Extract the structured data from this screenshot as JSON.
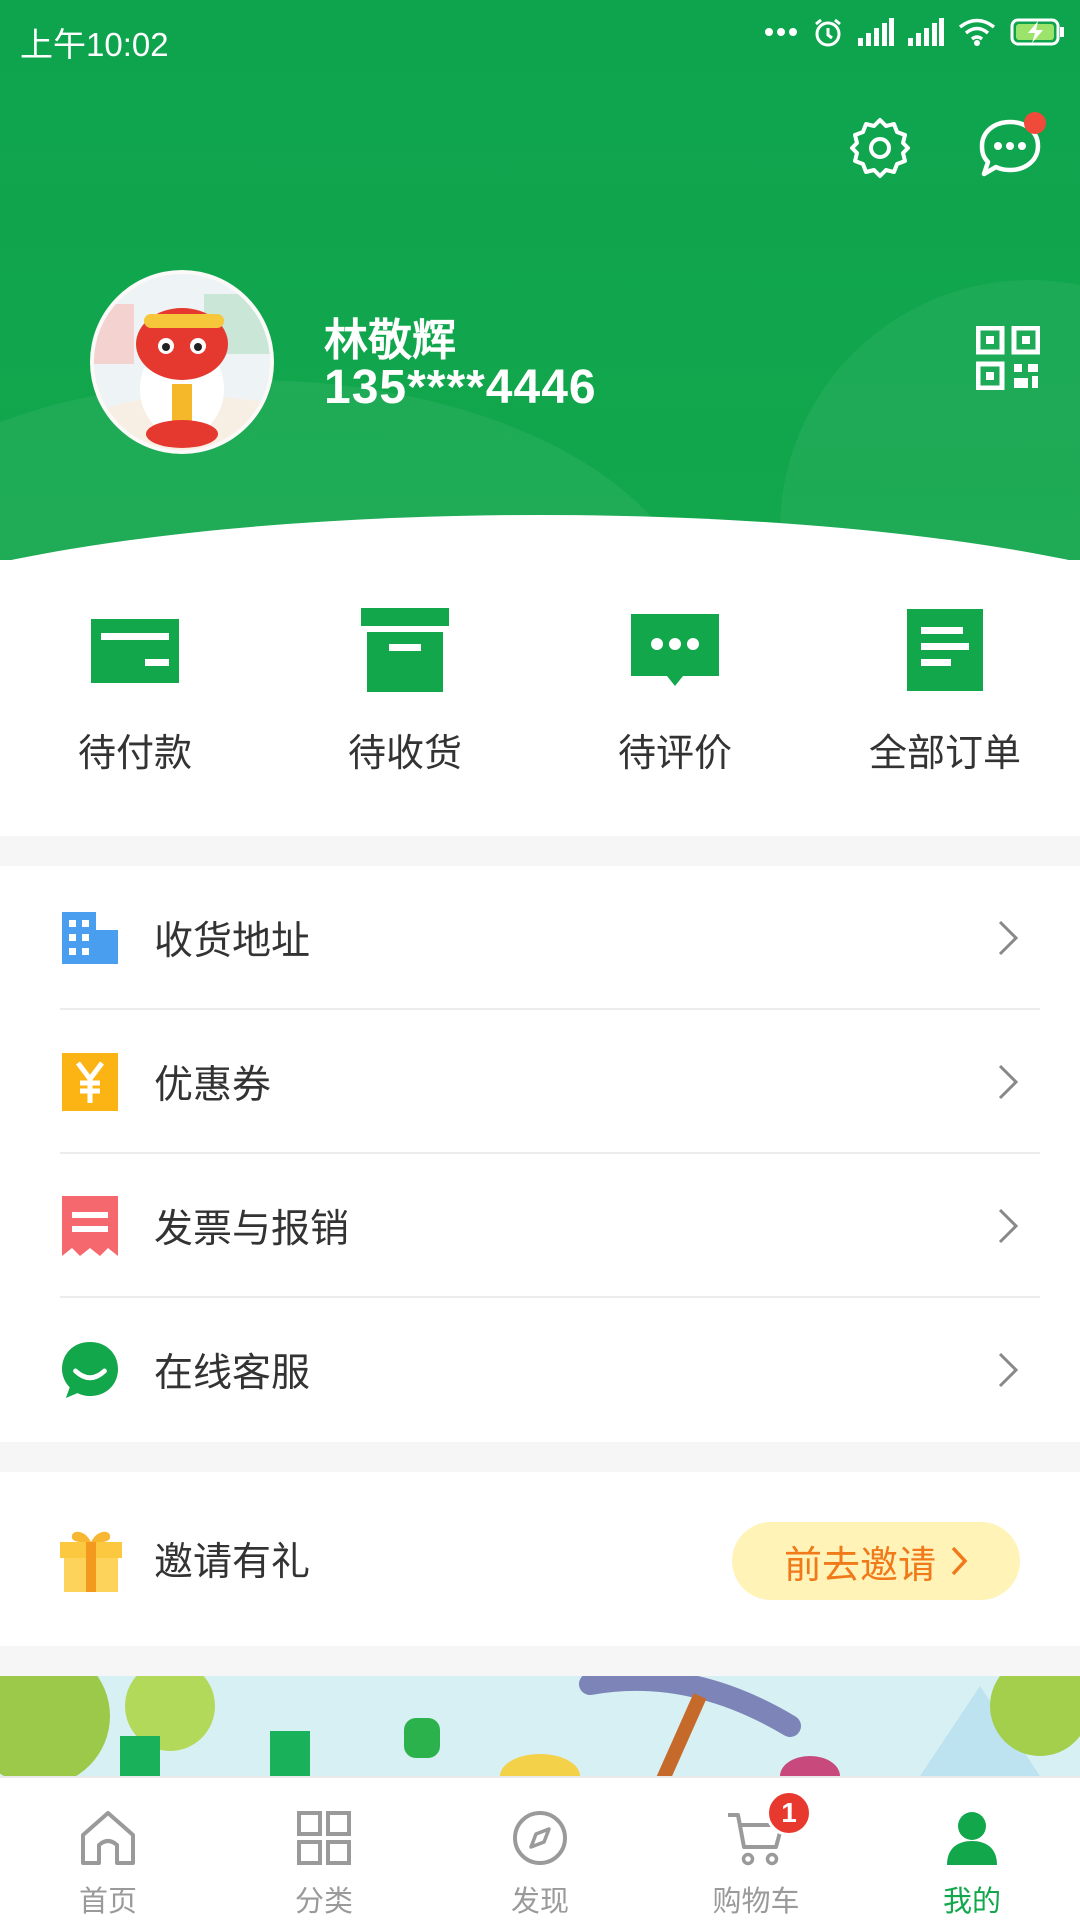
{
  "status_bar": {
    "time": "上午10:02"
  },
  "header": {
    "settings_icon": "gear-icon",
    "message_icon": "chat-bubble-icon",
    "qr_icon": "qr-code-icon"
  },
  "user": {
    "name": "林敬辉",
    "phone": "135****4446"
  },
  "orders": [
    {
      "label": "待付款",
      "icon": "wallet-icon"
    },
    {
      "label": "待收货",
      "icon": "box-icon"
    },
    {
      "label": "待评价",
      "icon": "comment-icon"
    },
    {
      "label": "全部订单",
      "icon": "orders-list-icon"
    }
  ],
  "menu": [
    {
      "label": "收货地址",
      "icon": "building-icon",
      "color": "#4a9ef0"
    },
    {
      "label": "优惠券",
      "icon": "yen-coupon-icon",
      "color": "#fbb414"
    },
    {
      "label": "发票与报销",
      "icon": "invoice-icon",
      "color": "#f4686e"
    },
    {
      "label": "在线客服",
      "icon": "support-smile-icon",
      "color": "#13a74c"
    }
  ],
  "invite": {
    "label": "邀请有礼",
    "button_label": "前去邀请"
  },
  "nav": {
    "items": [
      {
        "label": "首页",
        "icon": "home-icon"
      },
      {
        "label": "分类",
        "icon": "grid-icon"
      },
      {
        "label": "发现",
        "icon": "compass-icon"
      },
      {
        "label": "购物车",
        "icon": "cart-icon"
      },
      {
        "label": "我的",
        "icon": "user-icon"
      }
    ],
    "cart_badge": "1"
  },
  "colors": {
    "brand_green": "#13a74c",
    "badge_red": "#e8392f",
    "invite_orange": "#f07a1a"
  }
}
